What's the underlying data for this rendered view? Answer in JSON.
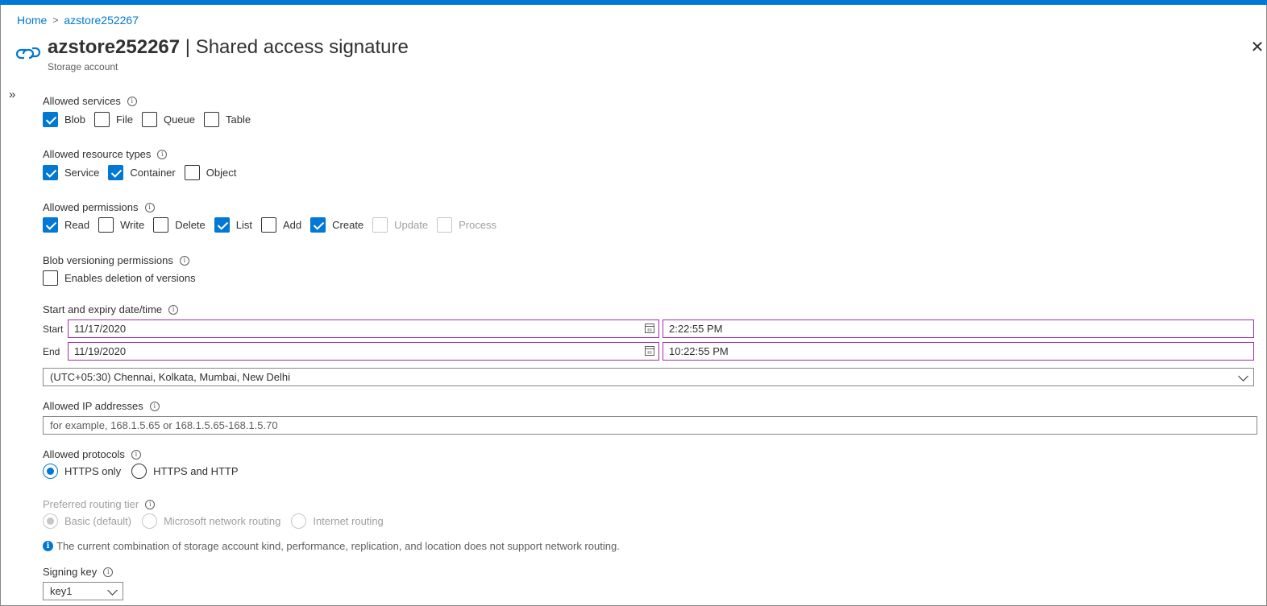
{
  "breadcrumb": {
    "home": "Home",
    "current": "azstore252267"
  },
  "header": {
    "resource_name": "azstore252267",
    "title_suffix": "| Shared access signature",
    "subtitle": "Storage account"
  },
  "allowed_services": {
    "label": "Allowed services",
    "items": [
      {
        "label": "Blob",
        "checked": true
      },
      {
        "label": "File",
        "checked": false
      },
      {
        "label": "Queue",
        "checked": false
      },
      {
        "label": "Table",
        "checked": false
      }
    ]
  },
  "allowed_resource_types": {
    "label": "Allowed resource types",
    "items": [
      {
        "label": "Service",
        "checked": true
      },
      {
        "label": "Container",
        "checked": true
      },
      {
        "label": "Object",
        "checked": false
      }
    ]
  },
  "allowed_permissions": {
    "label": "Allowed permissions",
    "items": [
      {
        "label": "Read",
        "checked": true
      },
      {
        "label": "Write",
        "checked": false
      },
      {
        "label": "Delete",
        "checked": false
      },
      {
        "label": "List",
        "checked": true
      },
      {
        "label": "Add",
        "checked": false
      },
      {
        "label": "Create",
        "checked": true
      },
      {
        "label": "Update",
        "checked": false,
        "disabled": true
      },
      {
        "label": "Process",
        "checked": false,
        "disabled": true
      }
    ]
  },
  "blob_versioning": {
    "label": "Blob versioning permissions",
    "option": "Enables deletion of versions"
  },
  "datetime": {
    "label": "Start and expiry date/time",
    "start_label": "Start",
    "start_date": "11/17/2020",
    "start_time": "2:22:55 PM",
    "end_label": "End",
    "end_date": "11/19/2020",
    "end_time": "10:22:55 PM",
    "timezone": "(UTC+05:30) Chennai, Kolkata, Mumbai, New Delhi"
  },
  "ip_addresses": {
    "label": "Allowed IP addresses",
    "placeholder": "for example, 168.1.5.65 or 168.1.5.65-168.1.5.70"
  },
  "protocols": {
    "label": "Allowed protocols",
    "options": [
      {
        "label": "HTTPS only",
        "selected": true
      },
      {
        "label": "HTTPS and HTTP",
        "selected": false
      }
    ]
  },
  "routing": {
    "label": "Preferred routing tier",
    "options": [
      {
        "label": "Basic (default)",
        "selected": true
      },
      {
        "label": "Microsoft network routing",
        "selected": false
      },
      {
        "label": "Internet routing",
        "selected": false
      }
    ],
    "notice": "The current combination of storage account kind, performance, replication, and location does not support network routing."
  },
  "signing_key": {
    "label": "Signing key",
    "value": "key1"
  },
  "icons": {
    "resource": "storage-link-icon",
    "info": "info-icon",
    "close": "close-icon",
    "expand": "double-chevron-right-icon",
    "calendar": "calendar-icon",
    "dropdown": "chevron-down-icon"
  },
  "colors": {
    "accent": "#0078d4",
    "invalid_border": "#a12da8",
    "text": "#323130",
    "disabled": "#a19f9d"
  }
}
